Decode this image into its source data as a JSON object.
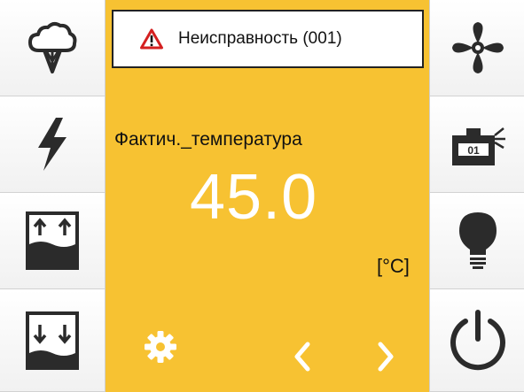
{
  "alarm": {
    "text": "Неисправность (001)",
    "icon": "warning-triangle-icon"
  },
  "display": {
    "label": "Фактич._температура",
    "value": "45.0",
    "unit": "[°C]"
  },
  "left_sidebar": [
    {
      "icon": "cloud-tree-icon"
    },
    {
      "icon": "lightning-icon"
    },
    {
      "icon": "fill-level-up-icon"
    },
    {
      "icon": "fill-level-down-icon"
    }
  ],
  "right_sidebar": [
    {
      "icon": "fan-icon"
    },
    {
      "icon": "program-display-icon",
      "text": "01"
    },
    {
      "icon": "light-bulb-icon"
    },
    {
      "icon": "power-icon"
    }
  ],
  "bottom_nav": {
    "settings": "gear-icon",
    "prev": "chevron-left-icon",
    "next": "chevron-right-icon"
  },
  "colors": {
    "accent": "#f7c232",
    "icon": "#2b2b2b",
    "warning": "#d42020"
  }
}
